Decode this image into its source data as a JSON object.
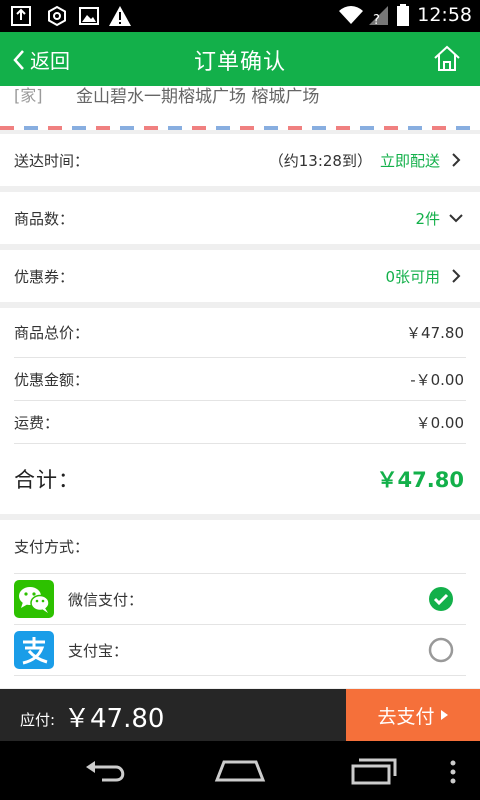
{
  "status": {
    "time": "12:58"
  },
  "header": {
    "back_label": "返回",
    "title": "订单确认"
  },
  "address": {
    "tag": "[家]",
    "text": "金山碧水一期榕城广场 榕城广场"
  },
  "delivery": {
    "label": "送达时间：",
    "eta": "（约13:28到）",
    "mode": "立即配送"
  },
  "items": {
    "label": "商品数：",
    "count": "2件"
  },
  "coupon": {
    "label": "优惠券：",
    "available": "0张可用"
  },
  "price": {
    "subtotal_label": "商品总价：",
    "subtotal": "￥47.80",
    "discount_label": "优惠金额：",
    "discount": "-￥0.00",
    "shipping_label": "运费：",
    "shipping": "￥0.00",
    "total_label": "合计：",
    "total": "￥47.80"
  },
  "payment": {
    "title": "支付方式：",
    "methods": [
      {
        "name": "微信支付：",
        "icon": "wechat-pay-icon",
        "selected": true
      },
      {
        "name": "支付宝：",
        "icon": "alipay-icon",
        "selected": false
      }
    ]
  },
  "footer": {
    "due_label": "应付:",
    "due_amount": "￥47.80",
    "pay_button": "去支付"
  },
  "colors": {
    "brand": "#13b04a",
    "accent": "#f5703a",
    "wechat": "#2dc100",
    "alipay": "#1a9de8"
  }
}
